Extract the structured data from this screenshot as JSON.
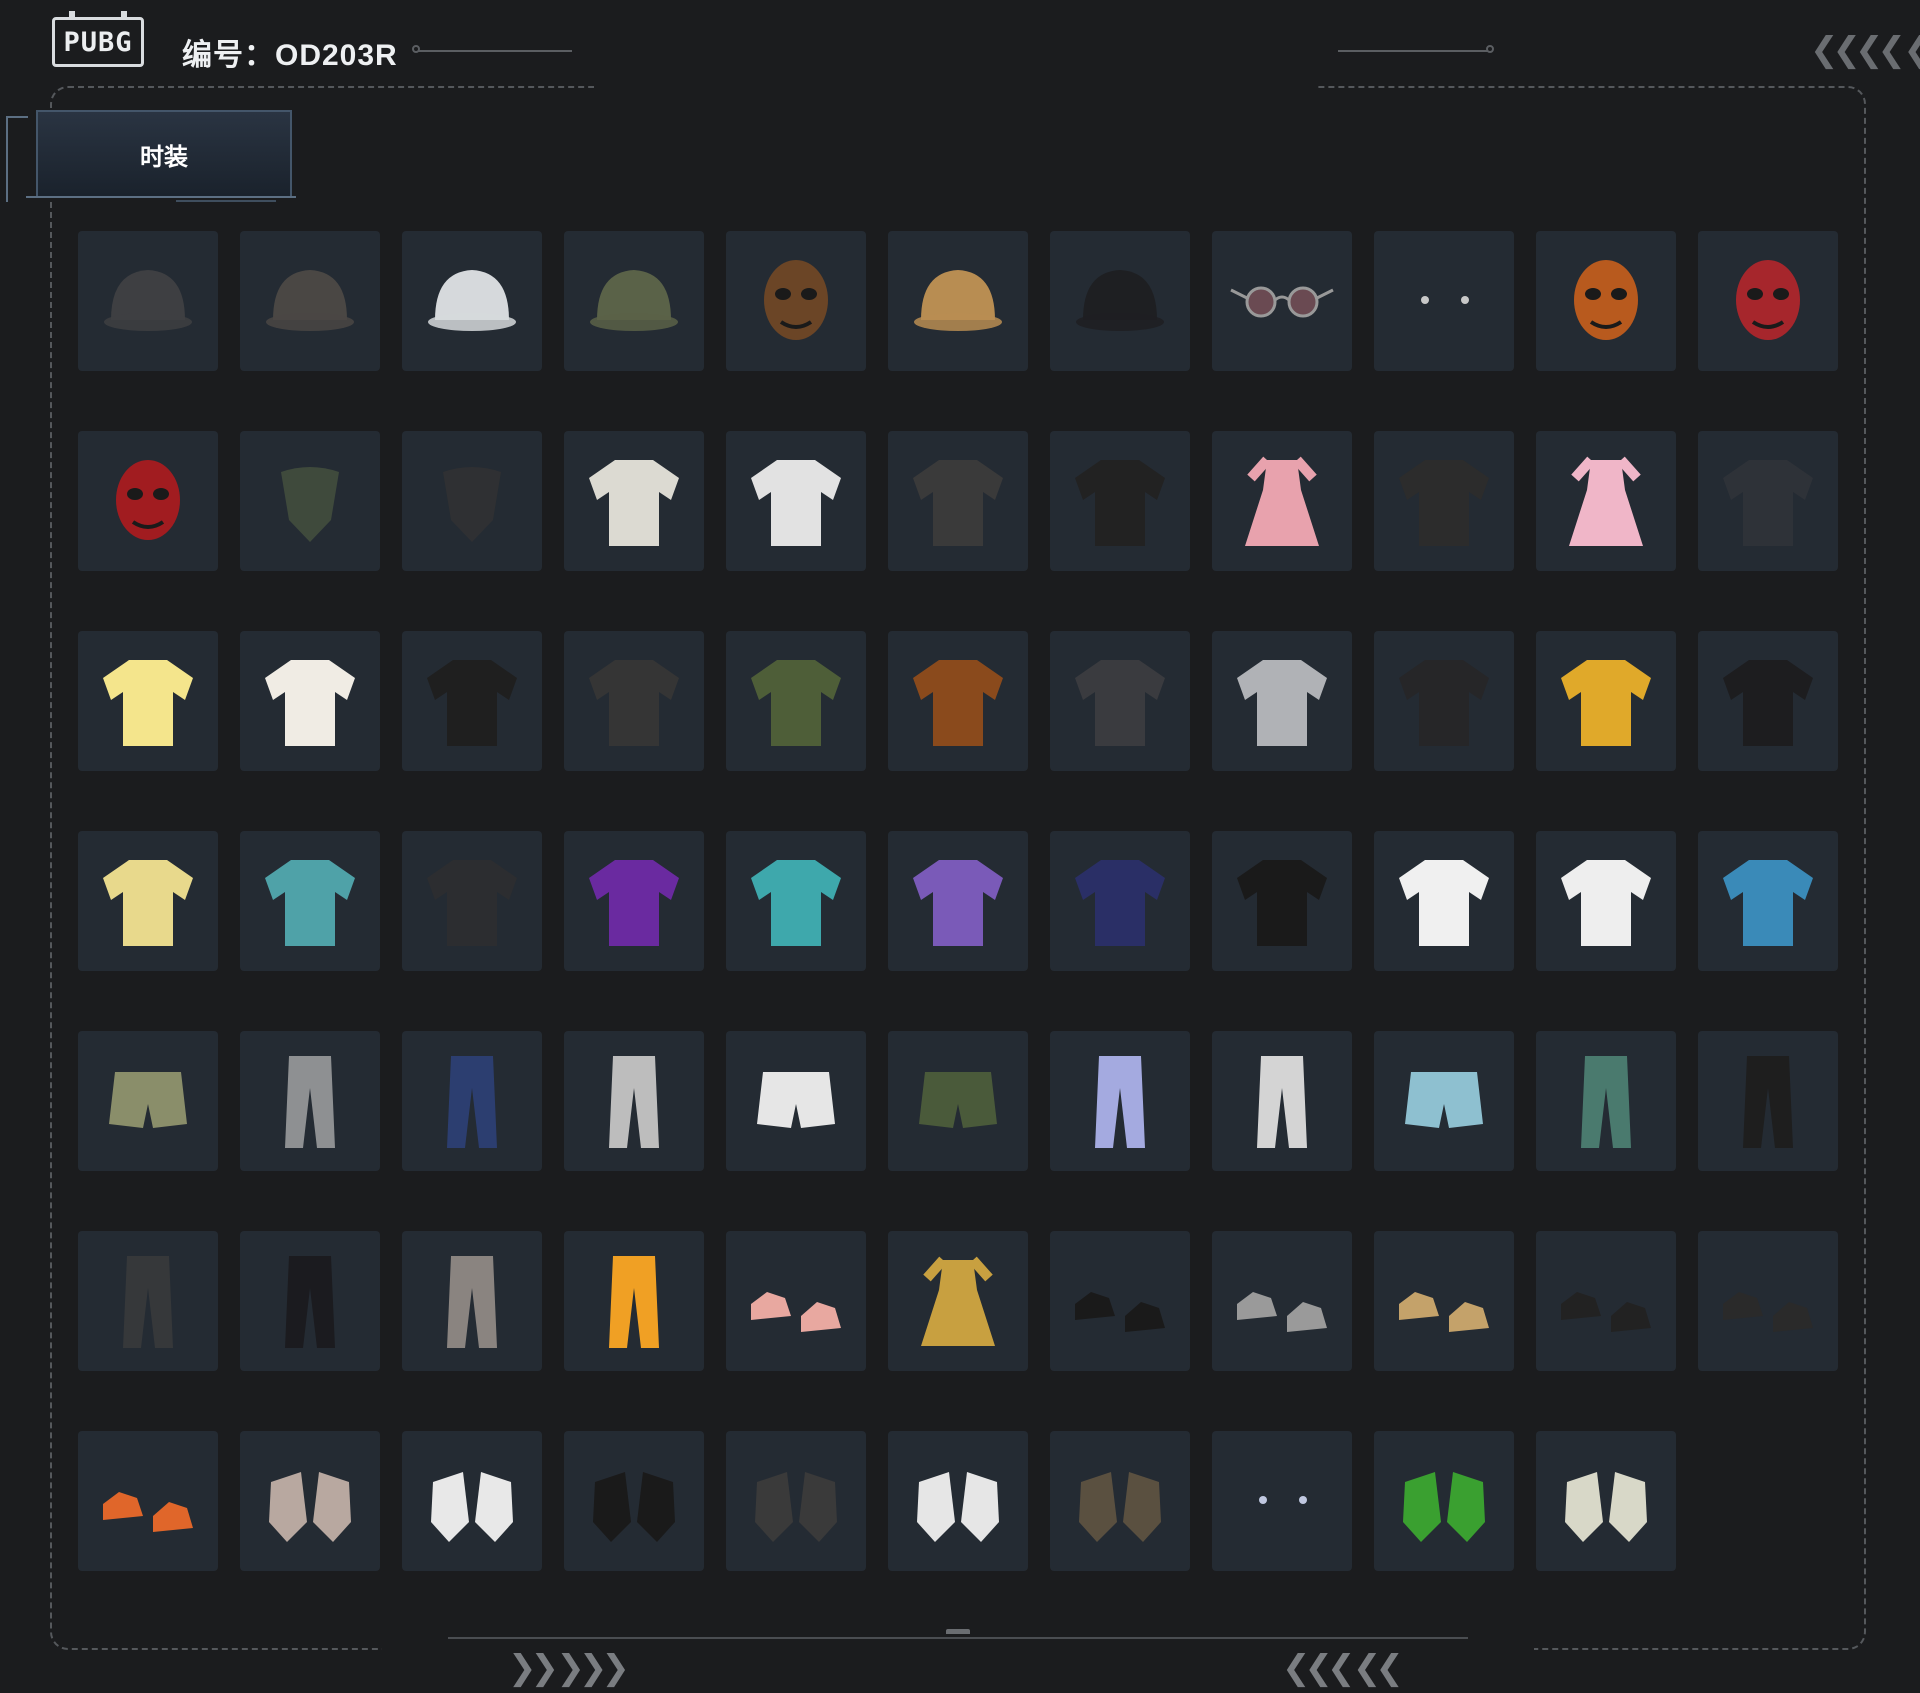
{
  "header": {
    "logo_text": "PUBG",
    "item_number": "编号：OD203R"
  },
  "tabs": [
    {
      "label": "时装",
      "active": true
    }
  ],
  "colors": {
    "background": "#1b1c1e",
    "cell_background": "#242b33",
    "frame_dash": "#55585c",
    "tab_border": "#44566a"
  },
  "items": [
    {
      "icon": "cat-ear-beanie",
      "color": "#3e3f42"
    },
    {
      "icon": "aviator-helmet-dreadlocks",
      "color": "#4a4744"
    },
    {
      "icon": "bucket-hat",
      "color": "#d6d9dc"
    },
    {
      "icon": "cap-headset",
      "color": "#5a6248"
    },
    {
      "icon": "bear-head",
      "color": "#6b4526"
    },
    {
      "icon": "patterned-bucket-hat",
      "color": "#b88d52"
    },
    {
      "icon": "black-cap",
      "color": "#1e1f22"
    },
    {
      "icon": "round-sunglasses",
      "color": "#6a4a52"
    },
    {
      "icon": "earrings",
      "color": "#c8c8c8"
    },
    {
      "icon": "pumpkin-mask",
      "color": "#b85a1e"
    },
    {
      "icon": "luchador-mask",
      "color": "#a6262c"
    },
    {
      "icon": "red-oni-mask",
      "color": "#a11c20"
    },
    {
      "icon": "camo-face-scarf",
      "color": "#3f4a3c"
    },
    {
      "icon": "black-face-scarf",
      "color": "#2f3033"
    },
    {
      "icon": "white-tshirt",
      "color": "#dcdad2"
    },
    {
      "icon": "mascot-tshirt",
      "color": "#e2e2e2"
    },
    {
      "icon": "graffiti-jacket",
      "color": "#3a3a3a"
    },
    {
      "icon": "black-tshirt-orange",
      "color": "#222"
    },
    {
      "icon": "pink-ruffle-dress",
      "color": "#e8a2ad"
    },
    {
      "icon": "black-tshirt-star",
      "color": "#2c2c2c"
    },
    {
      "icon": "pink-qipao",
      "color": "#f0b6c8"
    },
    {
      "icon": "tank-top-dark",
      "color": "#2e3238"
    },
    {
      "icon": "yellow-raglan-tee",
      "color": "#f4e58c"
    },
    {
      "icon": "retro-ringer-tee",
      "color": "#f0ece4"
    },
    {
      "icon": "black-tank-top",
      "color": "#1f1f1f"
    },
    {
      "icon": "sleeveless-top",
      "color": "#353535"
    },
    {
      "icon": "green-turtleneck",
      "color": "#4e5e38"
    },
    {
      "icon": "cow-print-coat",
      "color": "#8a4a1c"
    },
    {
      "icon": "red-hooded-jacket",
      "color": "#3a3b3f"
    },
    {
      "icon": "silver-bomber",
      "color": "#b0b2b6"
    },
    {
      "icon": "black-hoodie",
      "color": "#262628"
    },
    {
      "icon": "yellow-hoodie",
      "color": "#e0a92a"
    },
    {
      "icon": "black-leather-jacket",
      "color": "#1d1d1f"
    },
    {
      "icon": "yellow-fluffy-sweater",
      "color": "#e8d98c"
    },
    {
      "icon": "duck-hoodie",
      "color": "#4fa2a8"
    },
    {
      "icon": "dark-parka",
      "color": "#2c2d30"
    },
    {
      "icon": "purple-crop-jacket",
      "color": "#6a2aa0"
    },
    {
      "icon": "teal-windbreaker",
      "color": "#3ea8ac"
    },
    {
      "icon": "purple-track-jacket",
      "color": "#7a5ab8"
    },
    {
      "icon": "navy-sweatshirt",
      "color": "#2a2f66"
    },
    {
      "icon": "aura-hoodie",
      "color": "#1a1a1a"
    },
    {
      "icon": "white-hoodie",
      "color": "#f0f0f0"
    },
    {
      "icon": "orange-white-jacket",
      "color": "#eeeeee"
    },
    {
      "icon": "blue-gradient-hoodie",
      "color": "#3a8ab8"
    },
    {
      "icon": "khaki-skirt",
      "color": "#8a8e6a"
    },
    {
      "icon": "grey-joggers",
      "color": "#8e9092"
    },
    {
      "icon": "blue-cargo-pants",
      "color": "#2c3e70"
    },
    {
      "icon": "white-sweatpants",
      "color": "#bdbdbd"
    },
    {
      "icon": "denim-shorts-white",
      "color": "#e6e6e6"
    },
    {
      "icon": "green-basketball-shorts",
      "color": "#4a5a3a"
    },
    {
      "icon": "lavender-cargo-pants",
      "color": "#a4aae0"
    },
    {
      "icon": "white-graffiti-pants",
      "color": "#d4d4d4"
    },
    {
      "icon": "light-blue-shorts",
      "color": "#8ec0d0"
    },
    {
      "icon": "teal-shorts-leggings",
      "color": "#4a7a6e"
    },
    {
      "icon": "black-print-pants",
      "color": "#1e1e1e"
    },
    {
      "icon": "dark-cargo-pants",
      "color": "#36383a"
    },
    {
      "icon": "black-track-pants",
      "color": "#1b1b1f"
    },
    {
      "icon": "camo-cargo-pants",
      "color": "#8a8480"
    },
    {
      "icon": "orange-sweatpants",
      "color": "#f0a024"
    },
    {
      "icon": "pink-socks-shoes",
      "color": "#e8a8a0"
    },
    {
      "icon": "gold-dress-shoes",
      "color": "#c8a040"
    },
    {
      "icon": "black-racing-boots",
      "color": "#1a1a1a"
    },
    {
      "icon": "grey-high-tops",
      "color": "#9a9a9a"
    },
    {
      "icon": "tan-work-boots",
      "color": "#c4a26a"
    },
    {
      "icon": "black-sneakers",
      "color": "#222"
    },
    {
      "icon": "fur-trim-boots",
      "color": "#2a2a2a"
    },
    {
      "icon": "orange-hiking-boots",
      "color": "#e0662a"
    },
    {
      "icon": "bare-hand",
      "color": "#b8a8a0"
    },
    {
      "icon": "black-white-gloves",
      "color": "#e8e8e8"
    },
    {
      "icon": "black-fingerless-glove",
      "color": "#1a1a1a"
    },
    {
      "icon": "gold-trim-gloves",
      "color": "#3a3a3a"
    },
    {
      "icon": "white-racing-gloves",
      "color": "#e6e6e6"
    },
    {
      "icon": "tactical-gloves-orange",
      "color": "#5a5040"
    },
    {
      "icon": "nail-accessories",
      "color": "#c0c8e0"
    },
    {
      "icon": "green-gloves",
      "color": "#3aa030"
    },
    {
      "icon": "yellow-white-gloves",
      "color": "#d8d8c8"
    }
  ]
}
